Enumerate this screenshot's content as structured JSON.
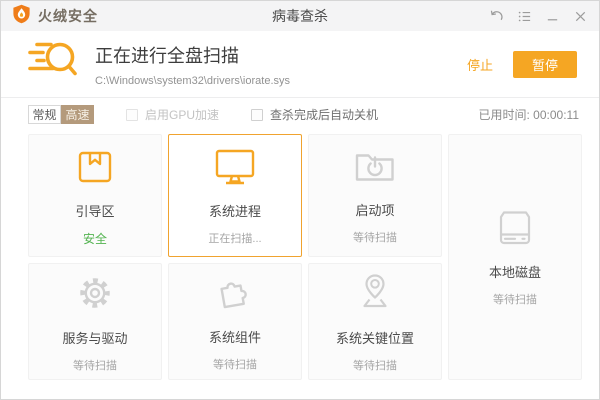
{
  "titlebar": {
    "app_name": "火绒安全",
    "page_title": "病毒查杀"
  },
  "header": {
    "title": "正在进行全盘扫描",
    "path": "C:\\Windows\\system32\\drivers\\iorate.sys",
    "stop_label": "停止",
    "pause_label": "暂停"
  },
  "toolbar": {
    "mode_normal": "常规",
    "mode_fast": "高速",
    "gpu_checkbox_label": "启用GPU加速",
    "shutdown_checkbox_label": "查杀完成后自动关机",
    "elapsed_label": "已用时间:",
    "elapsed_value": "00:00:11"
  },
  "scan_items": [
    {
      "label": "引导区",
      "status": "安全",
      "status_type": "safe",
      "icon": "boot-sector-icon",
      "active": false
    },
    {
      "label": "系统进程",
      "status": "正在扫描...",
      "status_type": "scanning",
      "icon": "system-process-icon",
      "active": true
    },
    {
      "label": "启动项",
      "status": "等待扫描",
      "status_type": "waiting",
      "icon": "startup-items-icon",
      "active": false
    },
    {
      "label": "本地磁盘",
      "status": "等待扫描",
      "status_type": "waiting",
      "icon": "local-disk-icon",
      "active": false
    },
    {
      "label": "服务与驱动",
      "status": "等待扫描",
      "status_type": "waiting",
      "icon": "services-drivers-icon",
      "active": false
    },
    {
      "label": "系统组件",
      "status": "等待扫描",
      "status_type": "waiting",
      "icon": "system-components-icon",
      "active": false
    },
    {
      "label": "系统关键位置",
      "status": "等待扫描",
      "status_type": "waiting",
      "icon": "system-critical-location-icon",
      "active": false
    }
  ],
  "colors": {
    "accent_orange": "#f5a623",
    "logo_orange": "#ef7d1a",
    "safe_green": "#53b350",
    "fast_mode_tan": "#b49a7c"
  }
}
